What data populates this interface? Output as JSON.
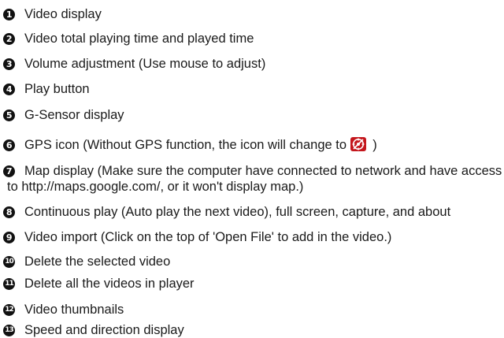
{
  "items": [
    {
      "num": "1",
      "text": "Video display"
    },
    {
      "num": "2",
      "text": "Video total playing time and played time"
    },
    {
      "num": "3",
      "text": "Volume adjustment (Use mouse to adjust)"
    },
    {
      "num": "4",
      "text": "Play button"
    },
    {
      "num": "5",
      "text": "G-Sensor display"
    },
    {
      "num": "6",
      "text": "GPS icon (Without GPS function, the icon will change to",
      "suffix": ")"
    },
    {
      "num": "7",
      "text": "Map display (Make sure the computer have connected to network and have access",
      "continuation": "to http://maps.google.com/, or it won't display map.)"
    },
    {
      "num": "8",
      "text": "Continuous play (Auto play the next video), full screen, capture, and about"
    },
    {
      "num": "9",
      "text": "Video import (Click on the top of 'Open File' to add in the video.)"
    },
    {
      "num": "10",
      "text": "Delete the selected video"
    },
    {
      "num": "11",
      "text": "Delete all the videos in player"
    },
    {
      "num": "12",
      "text": "Video thumbnails"
    },
    {
      "num": "13",
      "text": "Speed and direction display"
    }
  ],
  "icons": {
    "bullet": "filled-circle-number",
    "gps_off": "gps-off-icon"
  },
  "colors": {
    "text": "#1a1a1a",
    "bullet": "#111111",
    "gps_off_bg": "#c4161c"
  }
}
